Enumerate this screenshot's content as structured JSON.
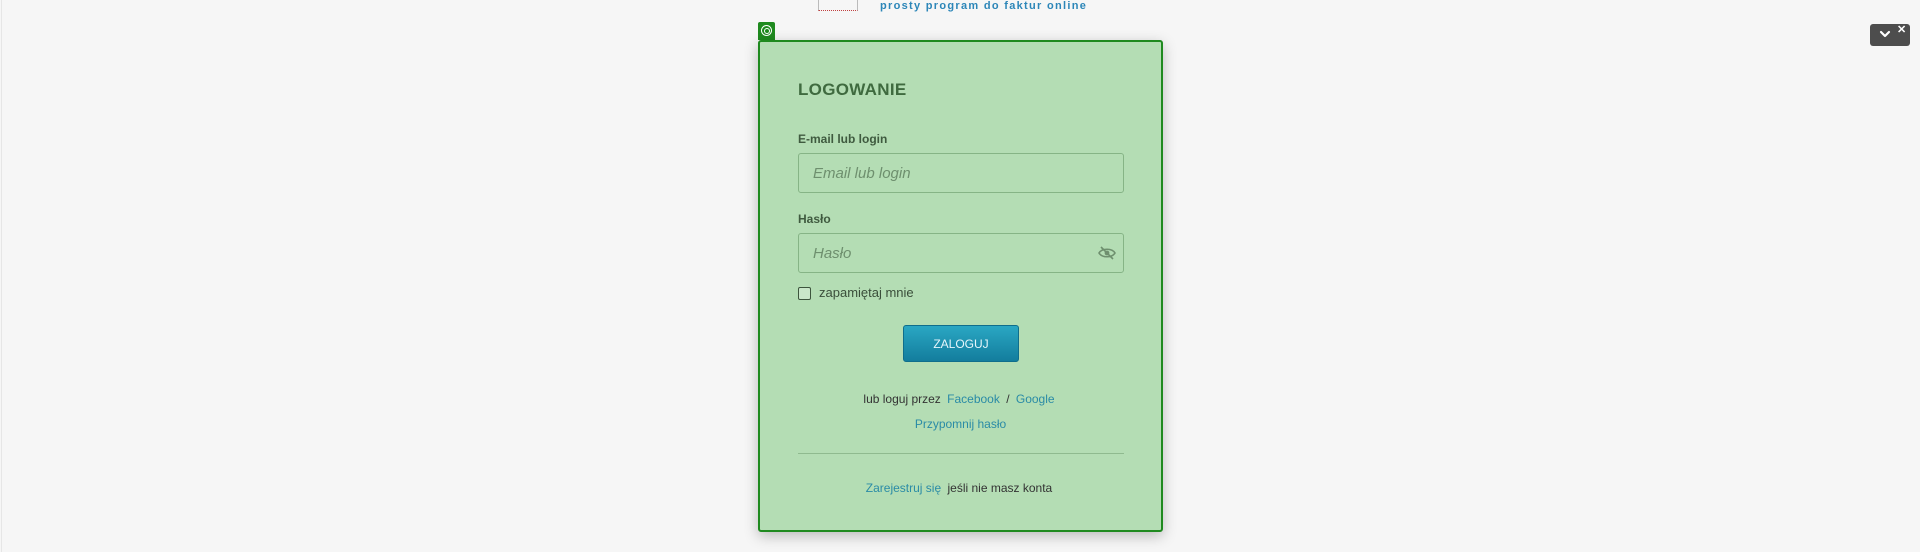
{
  "header": {
    "tagline": "prosty program do faktur online"
  },
  "login": {
    "title": "LOGOWANIE",
    "email_label": "E-mail lub login",
    "email_placeholder": "Email lub login",
    "email_value": "",
    "password_label": "Hasło",
    "password_placeholder": "Hasło",
    "password_value": "",
    "remember_label": "zapamiętaj mnie",
    "remember_checked": false,
    "submit_label": "ZALOGUJ",
    "social_prefix": "lub loguj przez",
    "facebook_label": "Facebook",
    "social_separator": "/",
    "google_label": "Google",
    "remind_label": "Przypomnij hasło",
    "register_link_label": "Zarejestruj się",
    "register_suffix": "jeśli nie masz konta"
  },
  "icons": {
    "password_toggle": "eye-slash-icon",
    "focus_tag": "target-icon",
    "corner_collapse": "chevron-down-icon",
    "corner_close": "close-icon"
  },
  "colors": {
    "card_background": "#b4ddb4",
    "card_border": "#1f8a1f",
    "button_accent": "#1a92b1",
    "link": "#2a8ba6"
  }
}
